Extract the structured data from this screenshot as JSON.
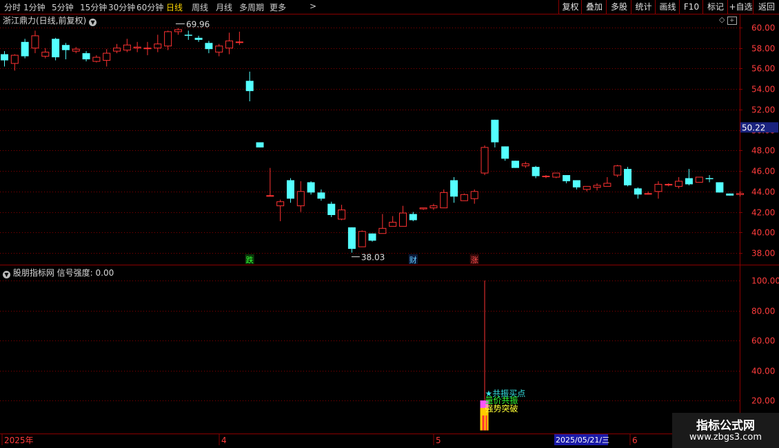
{
  "toolbar": {
    "periods": [
      "分时",
      "1分钟",
      "5分钟",
      "15分钟",
      "30分钟",
      "60分钟",
      "日线",
      "周线",
      "月线",
      "多周期",
      "更多"
    ],
    "active_period": "日线",
    "more_arrow": ">",
    "right_buttons": [
      "复权",
      "叠加",
      "多股",
      "统计",
      "画线",
      "F10",
      "标记",
      "+自选",
      "返回"
    ]
  },
  "price_panel": {
    "title": "浙江鼎力(日线,前复权)",
    "current_price_label": "50.22",
    "high_label": "69.96",
    "low_label": "38.03",
    "markers": [
      {
        "text": "跌",
        "color": "#33ff33",
        "bg": "#0a3a0a"
      },
      {
        "text": "财",
        "color": "#66ccff",
        "bg": "#0a1a3a"
      },
      {
        "text": "涨",
        "color": "#ff5050",
        "bg": "#3a0a0a"
      }
    ]
  },
  "indicator_panel": {
    "title": "股朋指标网",
    "signal_label": "信号强度:",
    "signal_value": "0.00",
    "annotations": [
      {
        "text": "★共振买点",
        "color": "#33e0e0"
      },
      {
        "text": "量价共振",
        "color": "#33ff33"
      },
      {
        "text": "强势突破",
        "color": "#ffff33"
      }
    ]
  },
  "date_axis": {
    "labels": [
      "2025年",
      "4",
      "5",
      "6"
    ],
    "cursor_date": "2025/05/21/三"
  },
  "watermark": {
    "title": "指标公式网",
    "url": "www.zbgs3.com"
  },
  "colors": {
    "up": "#ff3232",
    "down": "#54ffff",
    "grid": "#8b0000",
    "axis_text": "#ff3c3c"
  },
  "chart_data": [
    {
      "type": "candlestick",
      "title": "浙江鼎力(日线,前复权)",
      "ylim": [
        37,
        61.5
      ],
      "yticks": [
        38,
        40,
        42,
        44,
        46,
        48,
        50,
        52,
        54,
        56,
        58,
        60
      ],
      "candles": [
        [
          57.4,
          56.8,
          57.7,
          56.2
        ],
        [
          56.5,
          57.3,
          57.4,
          55.8
        ],
        [
          58.6,
          57.2,
          58.9,
          57.0
        ],
        [
          58.0,
          59.2,
          59.7,
          57.5
        ],
        [
          57.2,
          57.6,
          58.0,
          57.0
        ],
        [
          58.9,
          57.1,
          59.0,
          56.8
        ],
        [
          58.3,
          57.8,
          58.5,
          56.9
        ],
        [
          57.7,
          57.9,
          58.1,
          57.5
        ],
        [
          57.5,
          56.9,
          57.7,
          56.7
        ],
        [
          56.7,
          57.1,
          57.3,
          56.6
        ],
        [
          56.8,
          57.5,
          57.9,
          56.2
        ],
        [
          57.7,
          58.0,
          58.4,
          57.5
        ],
        [
          57.8,
          58.3,
          58.9,
          57.6
        ],
        [
          58.0,
          58.1,
          58.6,
          57.6
        ],
        [
          58.0,
          58.0,
          58.6,
          57.3
        ],
        [
          58.0,
          58.4,
          59.3,
          57.6
        ],
        [
          58.2,
          59.6,
          59.7,
          57.8
        ],
        [
          59.6,
          59.8,
          59.96,
          59.3
        ],
        [
          59.3,
          59.2,
          59.7,
          58.8
        ],
        [
          59.0,
          58.8,
          59.2,
          58.6
        ],
        [
          58.5,
          57.9,
          58.7,
          57.5
        ],
        [
          57.6,
          58.2,
          58.4,
          57.2
        ],
        [
          58.0,
          58.7,
          59.5,
          57.4
        ],
        [
          58.6,
          58.6,
          59.6,
          58.3
        ],
        [
          54.8,
          53.8,
          55.7,
          52.8
        ],
        [
          48.8,
          48.3,
          48.8,
          48.3
        ],
        [
          43.6,
          43.6,
          46.3,
          43.6
        ],
        [
          42.6,
          43.0,
          43.2,
          41.1
        ],
        [
          45.1,
          43.3,
          45.3,
          42.9
        ],
        [
          42.6,
          44.0,
          45.0,
          42.0
        ],
        [
          44.9,
          43.9,
          45.0,
          43.7
        ],
        [
          43.9,
          43.3,
          44.2,
          43.1
        ],
        [
          42.8,
          41.7,
          43.0,
          41.5
        ],
        [
          41.3,
          42.2,
          42.7,
          41.2
        ],
        [
          40.5,
          38.4,
          40.5,
          38.03
        ],
        [
          38.6,
          40.1,
          40.2,
          38.6
        ],
        [
          39.9,
          39.2,
          39.9,
          39.1
        ],
        [
          39.9,
          40.4,
          41.8,
          39.9
        ],
        [
          40.6,
          41.0,
          41.6,
          40.6
        ],
        [
          40.6,
          41.9,
          42.6,
          40.6
        ],
        [
          41.8,
          41.2,
          42.0,
          41.1
        ],
        [
          42.3,
          42.4,
          42.4,
          42.2
        ],
        [
          42.4,
          42.6,
          42.8,
          42.2
        ],
        [
          42.4,
          43.9,
          44.2,
          42.4
        ],
        [
          45.1,
          43.5,
          45.4,
          42.9
        ],
        [
          43.1,
          43.7,
          43.8,
          43.1
        ],
        [
          43.3,
          44.0,
          44.2,
          42.8
        ],
        [
          45.8,
          48.3,
          48.5,
          45.6
        ],
        [
          51.0,
          48.8,
          51.0,
          48.3
        ],
        [
          48.4,
          47.2,
          48.4,
          47.0
        ],
        [
          47.0,
          46.3,
          47.0,
          46.3
        ],
        [
          46.5,
          46.7,
          46.9,
          46.3
        ],
        [
          46.4,
          45.5,
          46.5,
          45.3
        ],
        [
          45.5,
          45.5,
          45.6,
          45.3
        ],
        [
          45.4,
          45.8,
          45.8,
          45.3
        ],
        [
          45.6,
          45.0,
          45.6,
          44.8
        ],
        [
          45.1,
          44.4,
          45.1,
          44.2
        ],
        [
          44.2,
          44.5,
          44.5,
          44.0
        ],
        [
          44.4,
          44.6,
          44.8,
          44.1
        ],
        [
          44.5,
          44.8,
          45.4,
          44.5
        ],
        [
          45.6,
          46.5,
          46.6,
          45.4
        ],
        [
          46.2,
          44.6,
          46.4,
          44.5
        ],
        [
          44.3,
          43.7,
          44.4,
          43.3
        ],
        [
          43.8,
          43.8,
          44.0,
          43.7
        ],
        [
          44.0,
          44.7,
          45.0,
          43.3
        ],
        [
          44.7,
          44.7,
          44.8,
          44.5
        ],
        [
          44.5,
          45.0,
          45.4,
          44.3
        ],
        [
          45.3,
          44.7,
          46.2,
          44.6
        ],
        [
          44.9,
          45.4,
          45.4,
          44.9
        ],
        [
          45.3,
          45.2,
          45.6,
          44.9
        ],
        [
          44.9,
          43.9,
          44.9,
          43.9
        ],
        [
          43.8,
          43.6,
          43.8,
          43.6
        ],
        [
          43.7,
          43.8,
          44.0,
          43.5
        ]
      ]
    },
    {
      "type": "bar",
      "title": "股朋指标网",
      "ylim": [
        0,
        103
      ],
      "yticks": [
        20,
        40,
        60,
        80,
        100
      ],
      "series": [
        {
          "name": "信号强度",
          "signal_index": 47,
          "values": [
            100.0,
            20.0,
            15.0,
            10.0
          ]
        }
      ]
    }
  ]
}
